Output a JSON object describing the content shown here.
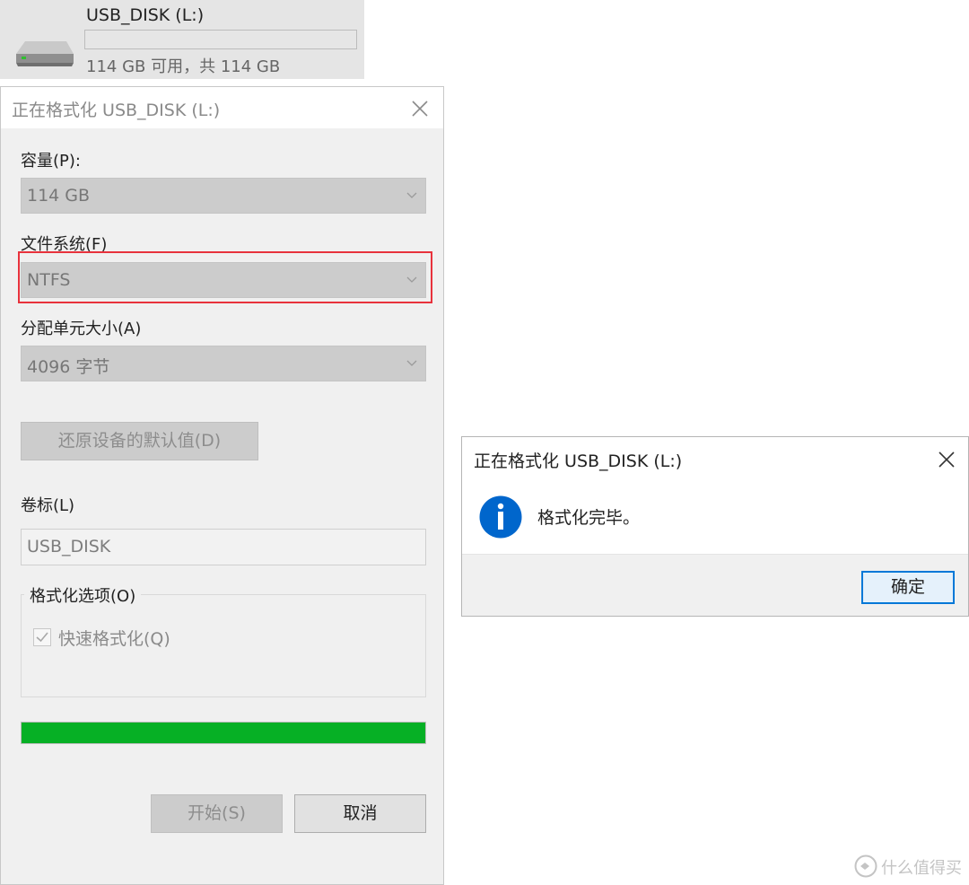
{
  "drive": {
    "name": "USB_DISK (L:)",
    "space_text": "114 GB 可用，共 114 GB",
    "used_fraction": 0,
    "icon": "usb-drive-icon"
  },
  "format_dialog": {
    "title": "正在格式化 USB_DISK (L:)",
    "capacity_label": "容量(P):",
    "capacity_value": "114 GB",
    "filesystem_label": "文件系统(F)",
    "filesystem_value": "NTFS",
    "allocation_label": "分配单元大小(A)",
    "allocation_value": "4096 字节",
    "restore_button": "还原设备的默认值(D)",
    "volume_label": "卷标(L)",
    "volume_value": "USB_DISK",
    "options_label": "格式化选项(O)",
    "quick_format_label": "快速格式化(Q)",
    "quick_format_checked": true,
    "progress_percent": 100,
    "start_button": "开始(S)",
    "cancel_button": "取消"
  },
  "message_box": {
    "title": "正在格式化 USB_DISK (L:)",
    "message": "格式化完毕。",
    "ok_button": "确定",
    "icon": "info-icon"
  },
  "watermark": {
    "text": "什么值得买"
  },
  "colors": {
    "progress": "#06b025",
    "highlight": "#e8323c",
    "info_blue": "#0066cc",
    "focus_border": "#0078d7"
  }
}
